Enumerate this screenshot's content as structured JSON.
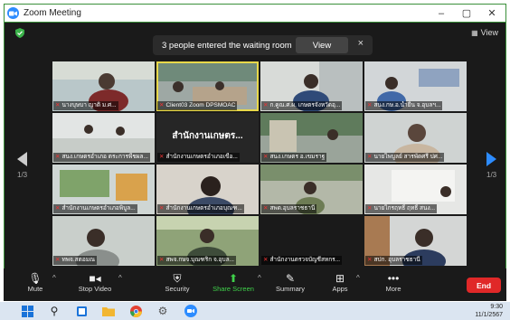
{
  "window": {
    "title": "Zoom Meeting",
    "minimize": "–",
    "maximize": "▢",
    "close": "✕"
  },
  "view_button": {
    "label": "View"
  },
  "notification": {
    "text": "3 people entered the waiting room",
    "view_label": "View",
    "close": "×"
  },
  "pagination": {
    "left": "1/3",
    "right": "1/3"
  },
  "tiles": [
    {
      "label": "นางบุษบา ญาติ ม.ศ..."
    },
    {
      "label": "Client03 Zoom DPSMOAC"
    },
    {
      "label": "ก.คูณ.ศ.ผ. เกษตรจังหวัดอุ..."
    },
    {
      "label": "สนง.กษ.อ.น้ำยืน จ.อุบลฯ..."
    },
    {
      "label": "สนง.เกษตรอำเภอ ตระการพืชผล..."
    },
    {
      "label": "สำนักงานเกษตรอำเภอเขื่อ...",
      "display_name": "สำนักงานเกษตร..."
    },
    {
      "label": "สนง.เกษตร อ.เขมราฐ"
    },
    {
      "label": "นายไพบูลย์ สารพัดศรี ปศ..."
    },
    {
      "label": "สำนักงานเกษตรอำเภอพิบูล..."
    },
    {
      "label": "สำนักงานเกษตรอำเภอบุณฑ..."
    },
    {
      "label": "สพด.อุบลราชธานี"
    },
    {
      "label": "นายไกรฤทธิ์ ฤทธิ์ สนง..."
    },
    {
      "label": "ทพจ.สตอมณ"
    },
    {
      "label": "สพจ.กษจ.บุณฑริก จ.อุบล..."
    },
    {
      "label": "สำนักงานตรวจบัญชีสหกร..."
    },
    {
      "label": "สปก. อุบลราชธานี"
    }
  ],
  "toolbar": {
    "mute": "Mute",
    "stop_video": "Stop Video",
    "security": "Security",
    "share_screen": "Share Screen",
    "summary": "Summary",
    "apps": "Apps",
    "more": "More",
    "end": "End"
  },
  "taskbar": {
    "time": "9:30",
    "date": "11/1/2567"
  },
  "colors": {
    "accent_green": "#3fd14a",
    "end_red": "#e02828",
    "zoom_blue": "#2D8CFF",
    "active_outline": "#e8d84a"
  }
}
